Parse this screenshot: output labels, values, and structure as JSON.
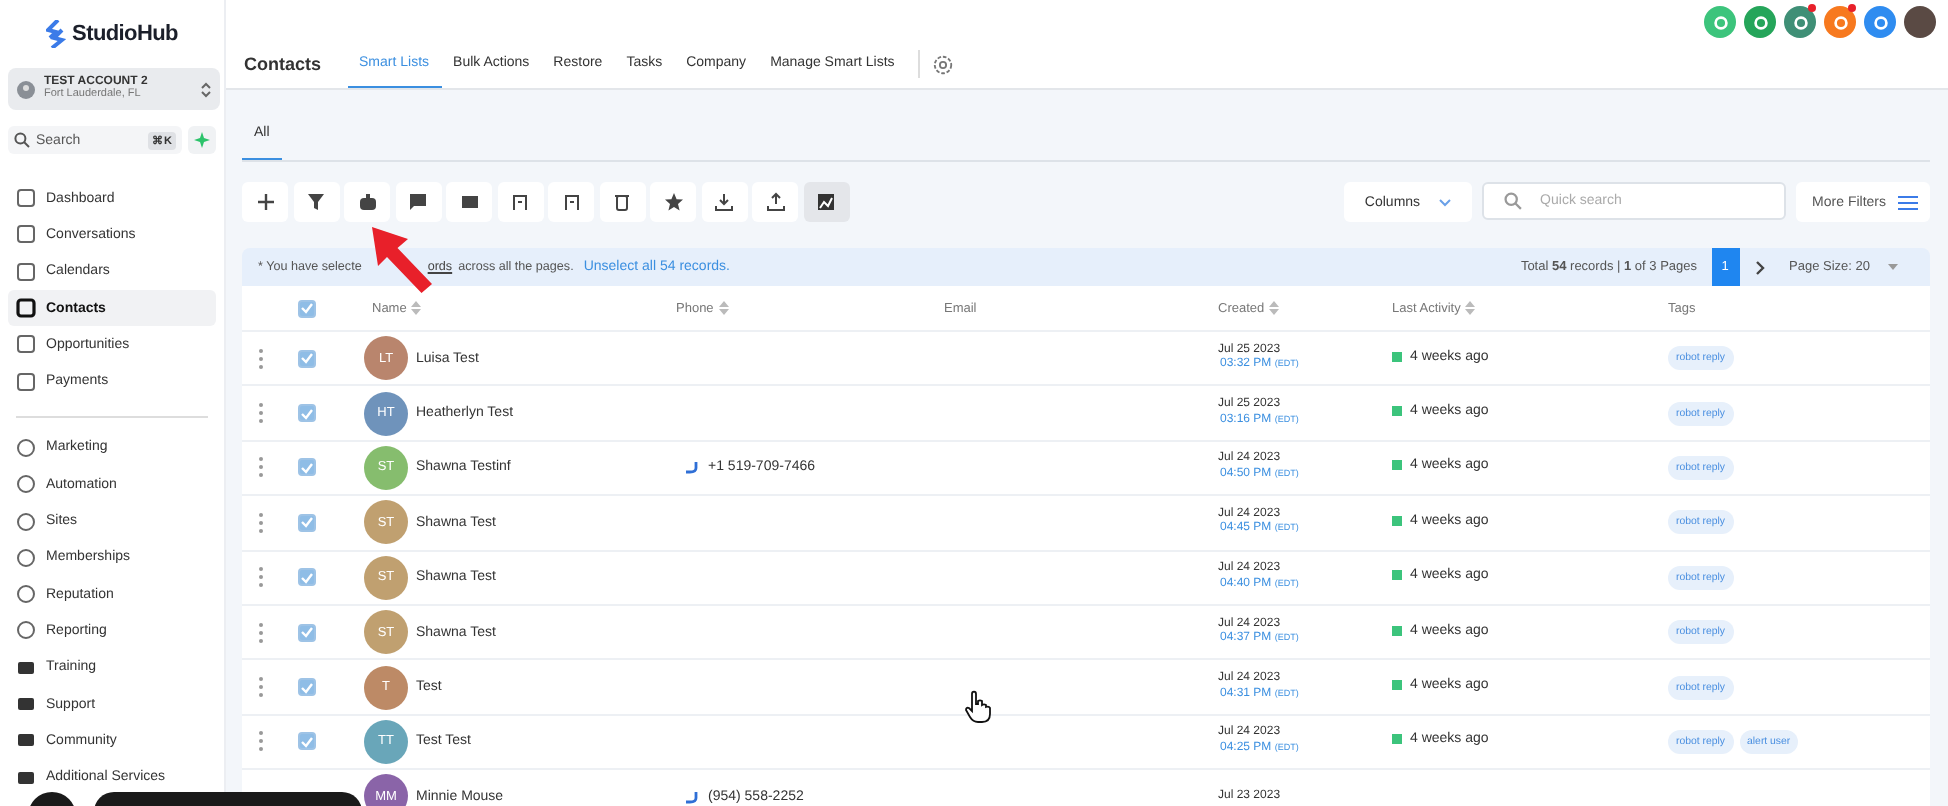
{
  "sidebar": {
    "brand": "StudioHub",
    "account": {
      "name": "TEST ACCOUNT 2",
      "location": "Fort Lauderdale, FL"
    },
    "search": {
      "placeholder": "Search",
      "shortcut": "⌘K"
    },
    "items": [
      {
        "label": "Dashboard",
        "selected": false
      },
      {
        "label": "Conversations",
        "selected": false
      },
      {
        "label": "Calendars",
        "selected": false
      },
      {
        "label": "Contacts",
        "selected": true
      },
      {
        "label": "Opportunities",
        "selected": false
      },
      {
        "label": "Payments",
        "selected": false
      }
    ],
    "items_2": [
      {
        "label": "Marketing"
      },
      {
        "label": "Automation"
      },
      {
        "label": "Sites"
      },
      {
        "label": "Memberships"
      },
      {
        "label": "Reputation"
      },
      {
        "label": "Reporting"
      },
      {
        "label": "Training"
      },
      {
        "label": "Support"
      },
      {
        "label": "Community"
      },
      {
        "label": "Additional Services"
      }
    ]
  },
  "header": {
    "title": "Contacts",
    "tabs": [
      {
        "label": "Smart Lists",
        "selected": true
      },
      {
        "label": "Bulk Actions",
        "selected": false
      },
      {
        "label": "Restore",
        "selected": false
      },
      {
        "label": "Tasks",
        "selected": false
      },
      {
        "label": "Company",
        "selected": false
      },
      {
        "label": "Manage Smart Lists",
        "selected": false
      }
    ],
    "top_icons": [
      {
        "color": "#3cc47c",
        "badge": false
      },
      {
        "color": "#25a55a",
        "badge": false
      },
      {
        "color": "#3f8f76",
        "badge": true
      },
      {
        "color": "#f7791f",
        "badge": true
      },
      {
        "color": "#2f8cf0",
        "badge": false
      }
    ]
  },
  "list_tabs": [
    {
      "label": "All",
      "selected": true
    }
  ],
  "toolbar": [
    {
      "selected": false
    },
    {
      "selected": false
    },
    {
      "selected": false
    },
    {
      "selected": false
    },
    {
      "selected": false
    },
    {
      "selected": false
    },
    {
      "selected": false
    },
    {
      "selected": false
    },
    {
      "selected": false
    },
    {
      "selected": false
    },
    {
      "selected": false
    },
    {
      "selected": true
    }
  ],
  "columns_button": "Columns",
  "quick_search": {
    "placeholder": "Quick search"
  },
  "more_filters": "More Filters",
  "banner": {
    "text_1": "* You have selecte",
    "link_1": "ords",
    "text_2": "across all the pages.",
    "link_2": "Unselect all 54 records.",
    "total": "Total **54** records | **1** of 3 Pages",
    "pages": [
      {
        "label": "1",
        "selected": true
      }
    ],
    "page_size": "Page Size: 20"
  },
  "table": {
    "columns": [
      "Name",
      "Phone",
      "Email",
      "Created",
      "Last Activity",
      "Tags"
    ],
    "header_checked": true,
    "rows": [
      {
        "checked": true,
        "initials": "LT",
        "color": "#b9856d",
        "name": "Luisa Test",
        "date": "Jul 25 2023",
        "time": "03:32 PM",
        "tz": "(EDT)",
        "activity": "4 weeks ago",
        "tags": [
          "robot reply"
        ]
      },
      {
        "checked": true,
        "initials": "HT",
        "color": "#6f93bb",
        "name": "Heatherlyn Test",
        "date": "Jul 25 2023",
        "time": "03:16 PM",
        "tz": "(EDT)",
        "activity": "4 weeks ago",
        "tags": [
          "robot reply"
        ]
      },
      {
        "checked": true,
        "initials": "ST",
        "color": "#86bd6e",
        "name": "Shawna Testinf",
        "phone": "+1 519-709-7466",
        "date": "Jul 24 2023",
        "time": "04:50 PM",
        "tz": "(EDT)",
        "activity": "4 weeks ago",
        "tags": [
          "robot reply"
        ]
      },
      {
        "checked": true,
        "initials": "ST",
        "color": "#c0a070",
        "name": "Shawna Test",
        "date": "Jul 24 2023",
        "time": "04:45 PM",
        "tz": "(EDT)",
        "activity": "4 weeks ago",
        "tags": [
          "robot reply"
        ]
      },
      {
        "checked": true,
        "initials": "ST",
        "color": "#c0a070",
        "name": "Shawna Test",
        "date": "Jul 24 2023",
        "time": "04:40 PM",
        "tz": "(EDT)",
        "activity": "4 weeks ago",
        "tags": [
          "robot reply"
        ]
      },
      {
        "checked": true,
        "initials": "ST",
        "color": "#c0a070",
        "name": "Shawna Test",
        "date": "Jul 24 2023",
        "time": "04:37 PM",
        "tz": "(EDT)",
        "activity": "4 weeks ago",
        "tags": [
          "robot reply"
        ]
      },
      {
        "checked": true,
        "initials": "T",
        "color": "#bd8a66",
        "name": "Test",
        "date": "Jul 24 2023",
        "time": "04:31 PM",
        "tz": "(EDT)",
        "activity": "4 weeks ago",
        "tags": [
          "robot reply"
        ]
      },
      {
        "checked": true,
        "initials": "TT",
        "color": "#69a6b9",
        "name": "Test Test",
        "date": "Jul 24 2023",
        "time": "04:25 PM",
        "tz": "(EDT)",
        "activity": "4 weeks ago",
        "tags": [
          "robot reply",
          "alert user"
        ]
      },
      {
        "initials": "MM",
        "color": "#8a64a8",
        "name": "Minnie Mouse",
        "phone": "(954) 558-2252",
        "date": "Jul 23 2023"
      }
    ]
  }
}
